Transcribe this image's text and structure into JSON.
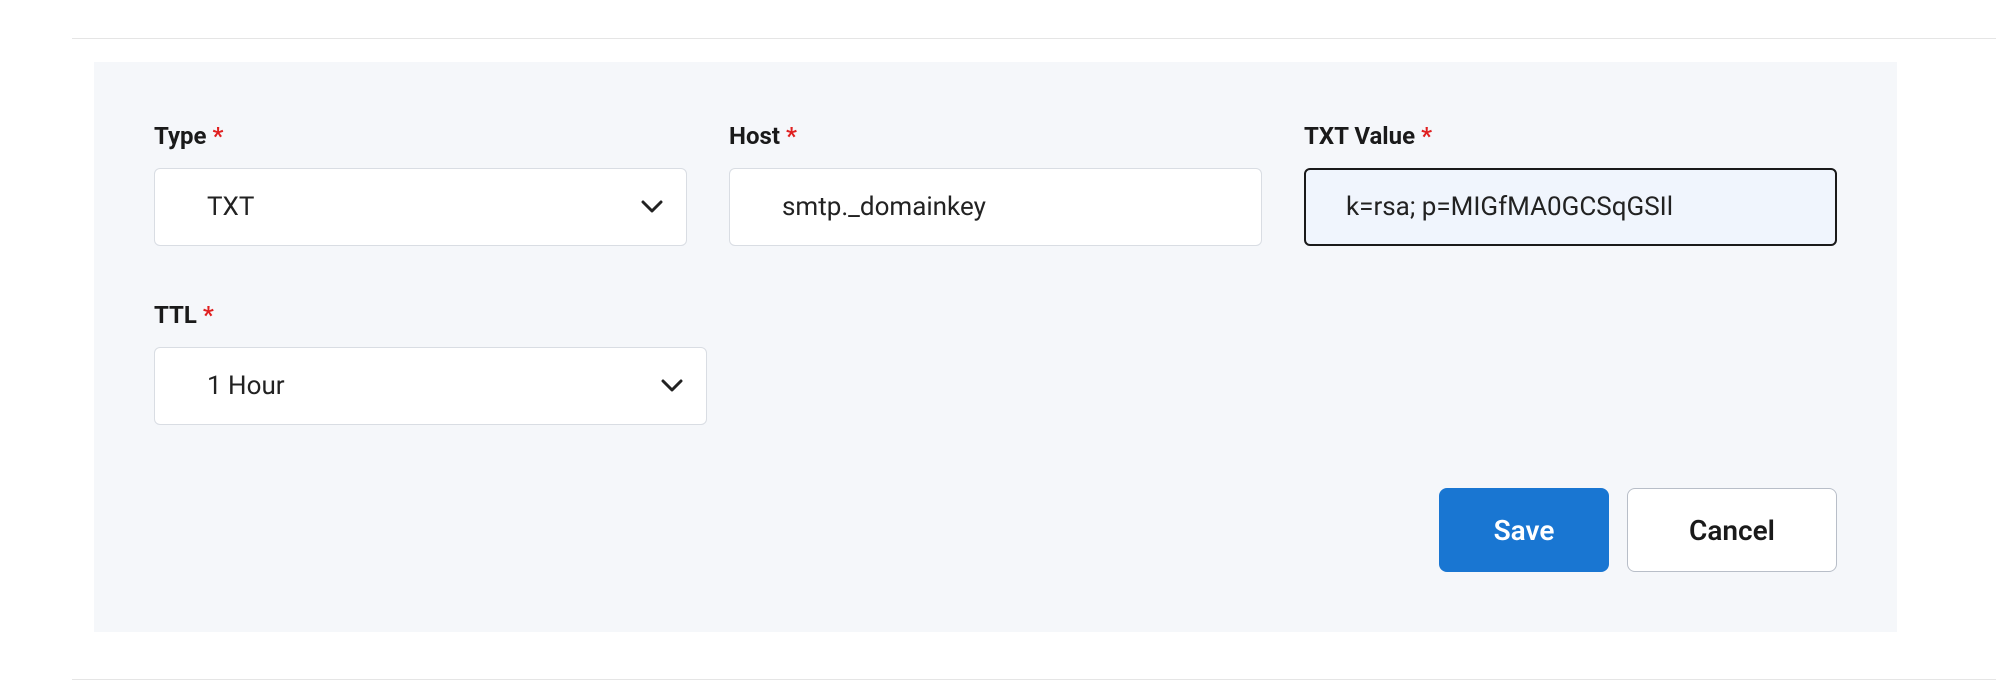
{
  "form": {
    "type": {
      "label": "Type",
      "value": "TXT"
    },
    "host": {
      "label": "Host",
      "value": "smtp._domainkey"
    },
    "txt_value": {
      "label": "TXT Value",
      "value": "k=rsa; p=MIGfMA0GCSqGSIl"
    },
    "ttl": {
      "label": "TTL",
      "value": "1 Hour"
    }
  },
  "buttons": {
    "save": "Save",
    "cancel": "Cancel"
  }
}
